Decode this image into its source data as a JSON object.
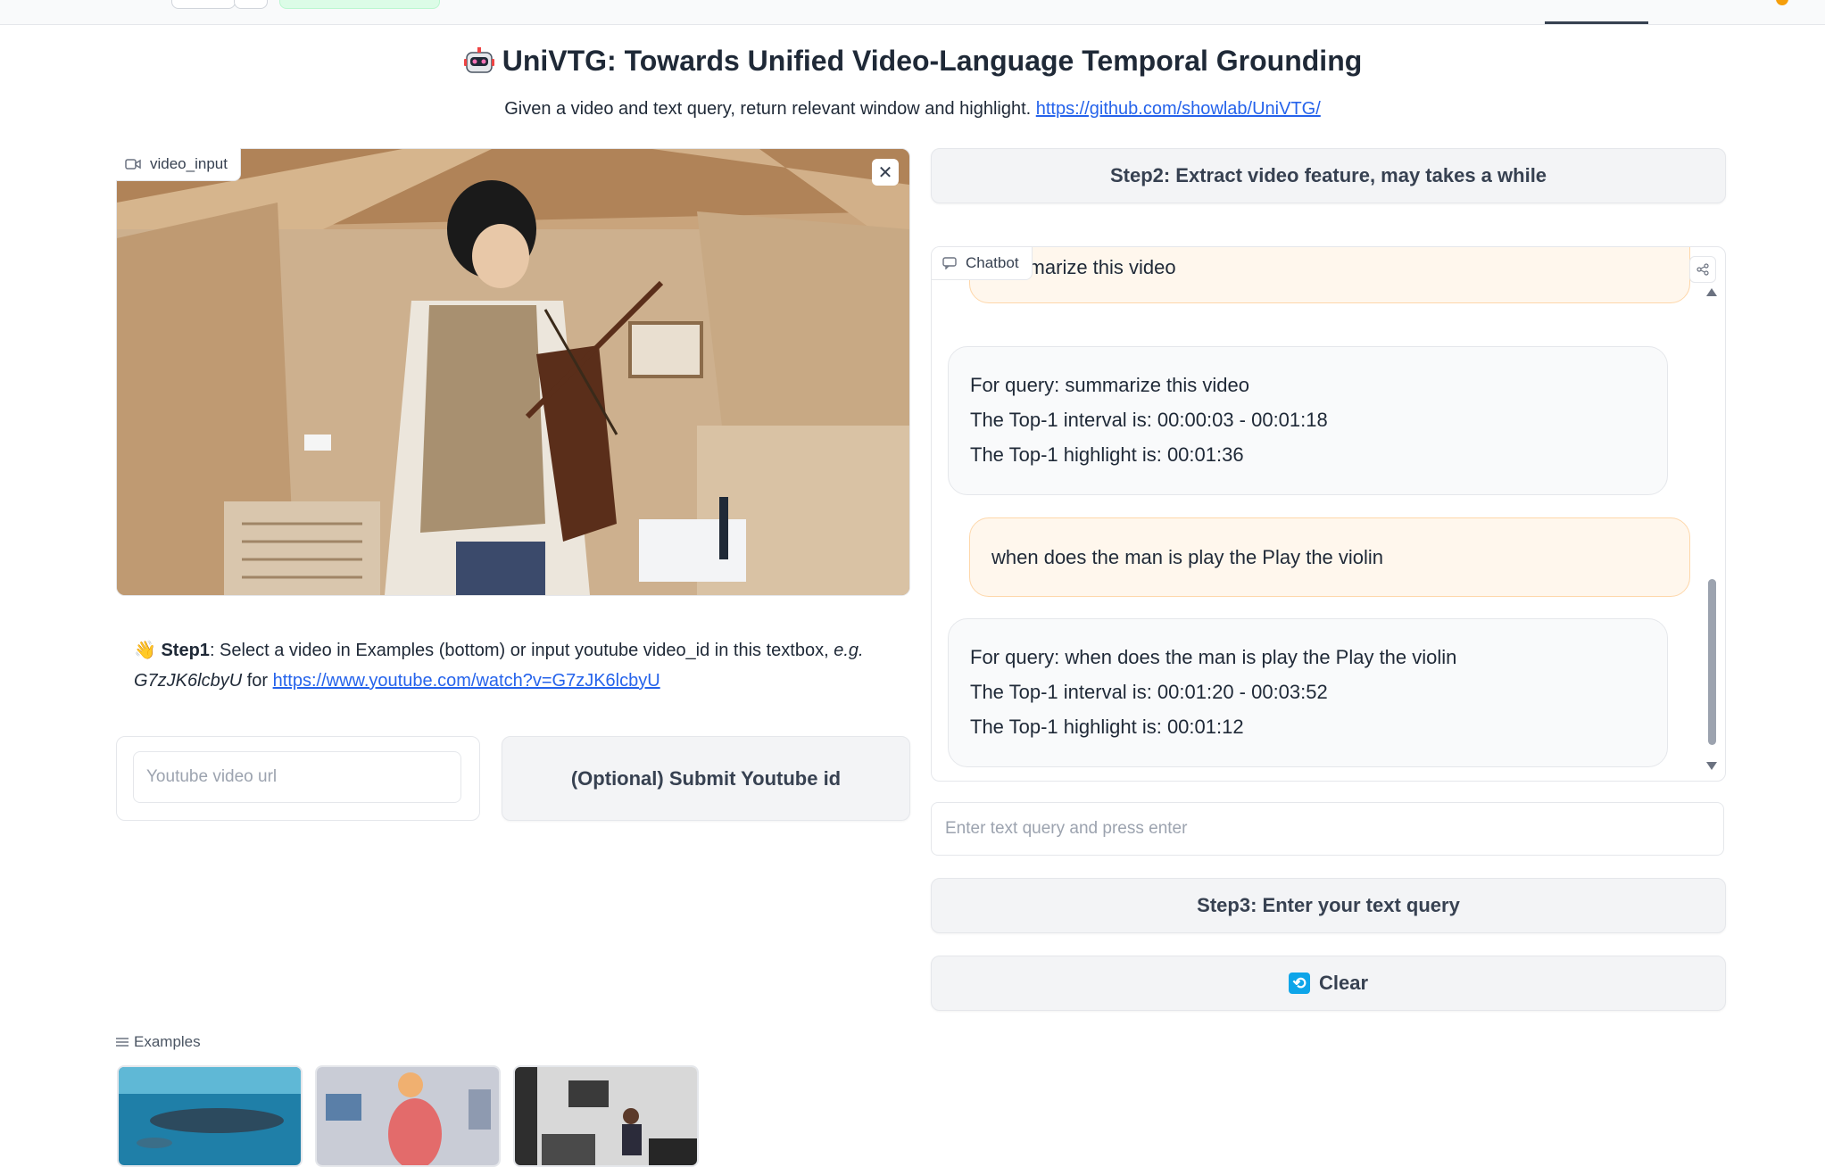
{
  "header": {
    "title": "UniVTG: Towards Unified Video-Language Temporal Grounding",
    "subtitle_text": "Given a video and text query, return relevant window and highlight.",
    "subtitle_link": "https://github.com/showlab/UniVTG/"
  },
  "video": {
    "label": "video_input",
    "close_symbol": "✕"
  },
  "step1": {
    "strong": "Step1",
    "text": ": Select a video in Examples (bottom) or input youtube video_id in this textbox, ",
    "eg": "e.g.",
    "example_id": "G7zJK6lcbyU",
    "for_text": " for ",
    "link": "https://www.youtube.com/watch?v=G7zJK6lcbyU"
  },
  "youtube": {
    "placeholder": "Youtube video url",
    "submit_label": "(Optional) Submit Youtube id"
  },
  "step2_label": "Step2: Extract video feature, may takes a while",
  "chatbot": {
    "label": "Chatbot",
    "messages": [
      {
        "role": "user",
        "lines": [
          "summarize this video"
        ]
      },
      {
        "role": "bot",
        "lines": [
          "For query: summarize this video",
          "The Top-1 interval is: 00:00:03 - 00:01:18",
          "The Top-1 highlight is: 00:01:36"
        ]
      },
      {
        "role": "user",
        "lines": [
          "when does the man is play the Play the violin"
        ]
      },
      {
        "role": "bot",
        "lines": [
          "For query: when does the man is play the Play the violin",
          "The Top-1 interval is: 00:01:20 - 00:03:52",
          "The Top-1 highlight is: 00:01:12"
        ]
      }
    ]
  },
  "query": {
    "placeholder": "Enter text query and press enter"
  },
  "step3_label": "Step3: Enter your text query",
  "clear": {
    "icon_glyph": "⟲",
    "label": "Clear"
  },
  "examples": {
    "label": "Examples"
  }
}
